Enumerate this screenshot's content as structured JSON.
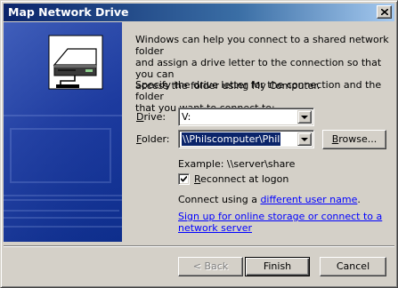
{
  "window": {
    "title": "Map Network Drive"
  },
  "intro_text": "Windows can help you connect to a shared network folder\nand assign a drive letter to the connection so that you can\naccess the folder using My Computer.",
  "specify_text": "Specify the drive letter for the connection and the folder\nthat you want to connect to:",
  "drive": {
    "label_accel": "D",
    "label_rest": "rive:",
    "value": "V:"
  },
  "folder": {
    "label_accel": "F",
    "label_rest": "older:",
    "value": "\\\\Philscomputer\\Phil"
  },
  "browse_button": {
    "label_accel": "B",
    "label_rest": "rowse..."
  },
  "example_text": "Example: \\\\server\\share",
  "reconnect": {
    "label_accel": "R",
    "label_rest": "econnect at logon",
    "checked": true
  },
  "connect_using": {
    "prefix": "Connect using a ",
    "link": "different user name",
    "suffix": "."
  },
  "signup_link": "Sign up for online storage or connect to a network server",
  "buttons": {
    "back": "< Back",
    "finish": "Finish",
    "cancel": "Cancel"
  },
  "colors": {
    "title_gradient_start": "#0a246a",
    "title_gradient_end": "#a6caf0",
    "side_panel": "#1c3aa0",
    "dialog_face": "#d4d0c8",
    "link": "#0000ff"
  },
  "icons": [
    "close-icon",
    "network-drive-icon",
    "dropdown-arrow-icon",
    "check-icon"
  ]
}
